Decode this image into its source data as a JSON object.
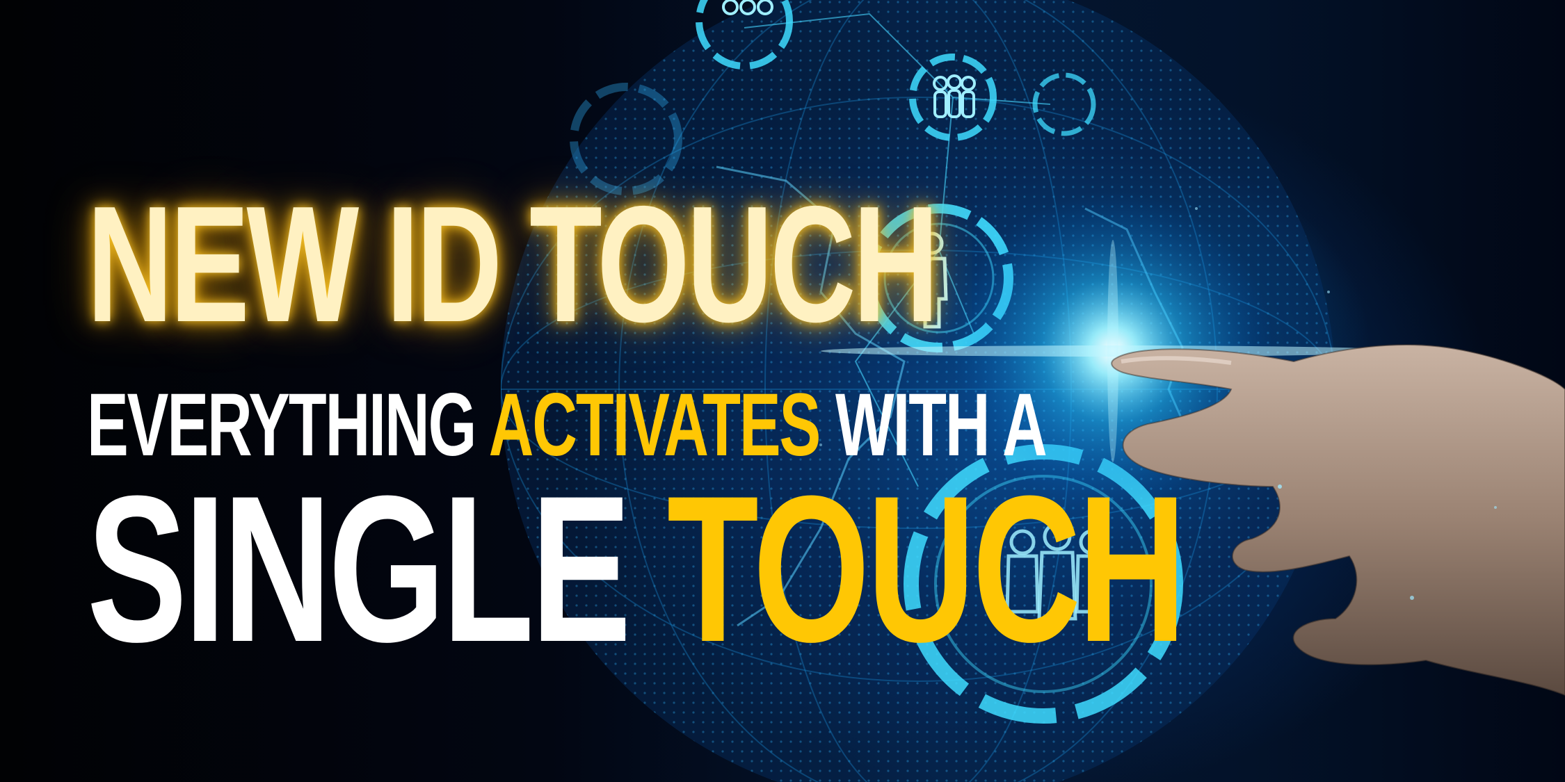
{
  "headline": {
    "line1": "NEW ID TOUCH",
    "line2_a": "EVERYTHING",
    "line2_b": "ACTIVATES",
    "line2_c": "WITH A",
    "line3_a": "SINGLE",
    "line3_b": "TOUCH"
  },
  "colors": {
    "glow_yellow": "#fff1c2",
    "accent_yellow": "#ffc704",
    "text_white": "#ffffff",
    "cyan_glow": "#39e0ff",
    "background_dark": "#02050c",
    "background_blue": "#0a5aaa"
  },
  "illustration": {
    "globe": "digital-globe",
    "hand": "pointing-hand",
    "icons": [
      "group-people-icon",
      "person-icon",
      "people-icon"
    ]
  }
}
